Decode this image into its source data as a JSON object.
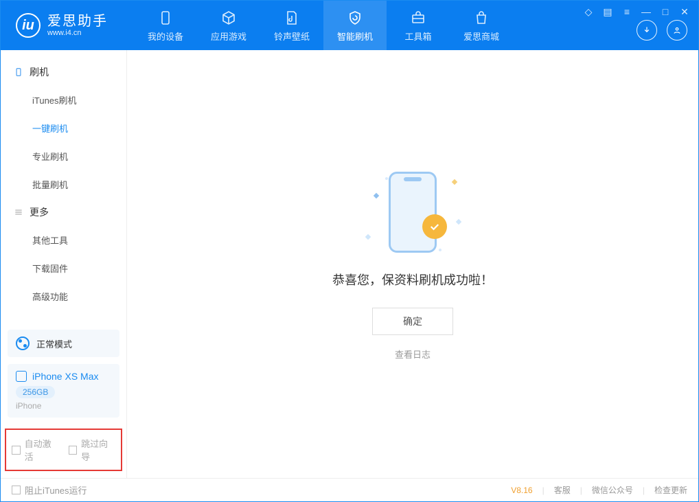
{
  "app": {
    "name": "爱思助手",
    "site": "www.i4.cn"
  },
  "tabs": {
    "device": "我的设备",
    "apps": "应用游戏",
    "ring": "铃声壁纸",
    "flash": "智能刷机",
    "tools": "工具箱",
    "store": "爱思商城"
  },
  "sidebar": {
    "group_flash": "刷机",
    "group_more": "更多",
    "items": {
      "itunes": "iTunes刷机",
      "oneclick": "一键刷机",
      "pro": "专业刷机",
      "batch": "批量刷机",
      "other": "其他工具",
      "download": "下载固件",
      "advanced": "高级功能"
    },
    "mode": "正常模式",
    "device": {
      "name": "iPhone XS Max",
      "storage": "256GB",
      "type": "iPhone"
    },
    "cb_activate": "自动激活",
    "cb_skip": "跳过向导"
  },
  "main": {
    "success_msg": "恭喜您，保资料刷机成功啦！",
    "ok": "确定",
    "view_log": "查看日志"
  },
  "footer": {
    "block_itunes": "阻止iTunes运行",
    "version": "V8.16",
    "support": "客服",
    "wechat": "微信公众号",
    "update": "检查更新"
  }
}
